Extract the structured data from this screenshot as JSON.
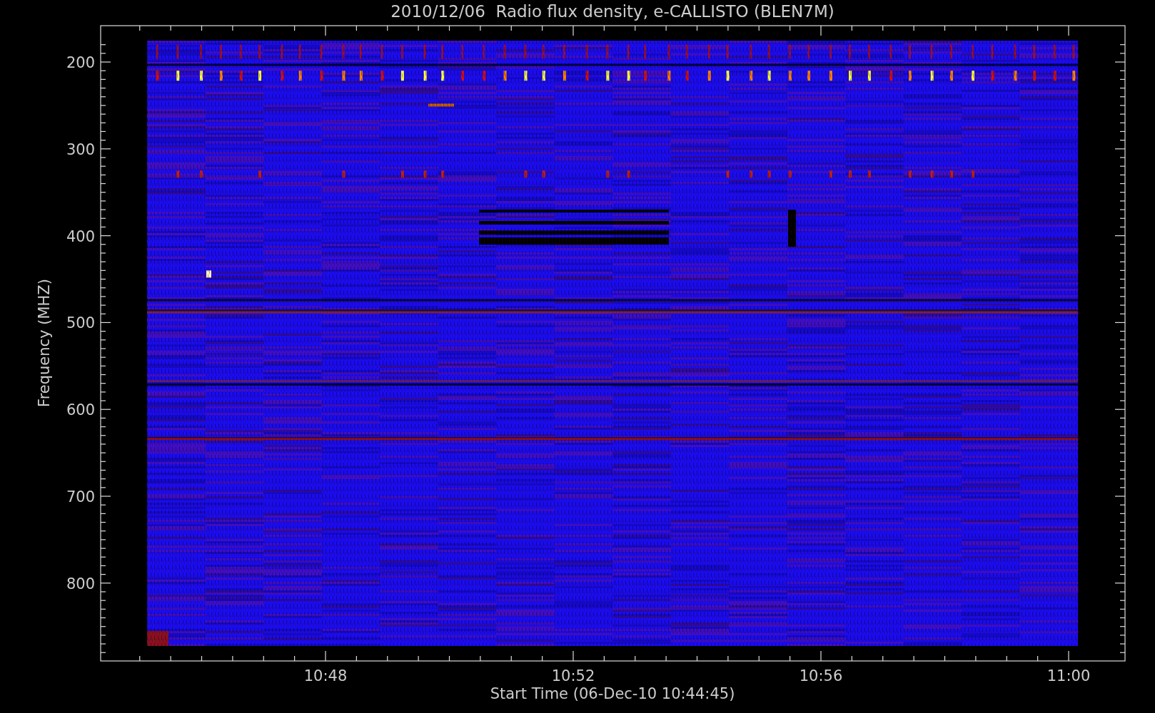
{
  "title": "2010/12/06  Radio flux density, e-CALLISTO (BLEN7M)",
  "ylabel": "Frequency (MHZ)",
  "xlabel": "Start Time (06-Dec-10 10:44:45)",
  "yticks": [
    "200",
    "300",
    "400",
    "500",
    "600",
    "700",
    "800"
  ],
  "xticks": [
    "10:48",
    "10:52",
    "10:56",
    "11:00"
  ]
}
